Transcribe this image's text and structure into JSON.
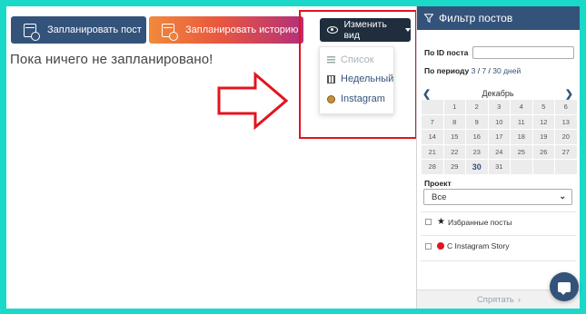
{
  "toolbar": {
    "schedule_post_label": "Запланировать пост",
    "schedule_story_label": "Запланировать историю",
    "change_view_label": "Изменить вид"
  },
  "main": {
    "empty_message": "Пока ничего не запланировано!"
  },
  "view_menu": {
    "items": [
      {
        "label": "Список",
        "icon": "list-icon",
        "state": "disabled"
      },
      {
        "label": "Недельный",
        "icon": "calendar-week-icon",
        "state": "normal"
      },
      {
        "label": "Instagram",
        "icon": "instagram-icon",
        "state": "normal"
      }
    ]
  },
  "filter": {
    "title": "Фильтр постов",
    "post_id_label": "По ID поста",
    "post_id_value": "",
    "period_label": "По периоду",
    "period_options": [
      "3",
      "7",
      "30 дней"
    ],
    "calendar": {
      "month": "Декабрь",
      "today": "30",
      "days": [
        "",
        "1",
        "2",
        "3",
        "4",
        "5",
        "6",
        "7",
        "8",
        "9",
        "10",
        "11",
        "12",
        "13",
        "14",
        "15",
        "16",
        "17",
        "18",
        "19",
        "20",
        "21",
        "22",
        "23",
        "24",
        "25",
        "26",
        "27",
        "28",
        "29",
        "30",
        "31",
        "",
        "",
        ""
      ]
    },
    "project_label": "Проект",
    "project_value": "Все",
    "favorites_label": "Избранные посты",
    "story_label": "С Instagram Story",
    "hide_label": "Спрятать"
  },
  "colors": {
    "navy": "#34537a",
    "dark_button": "#1f2d3d",
    "highlight_red": "#e3141e",
    "background_teal": "#1ad9c9"
  }
}
